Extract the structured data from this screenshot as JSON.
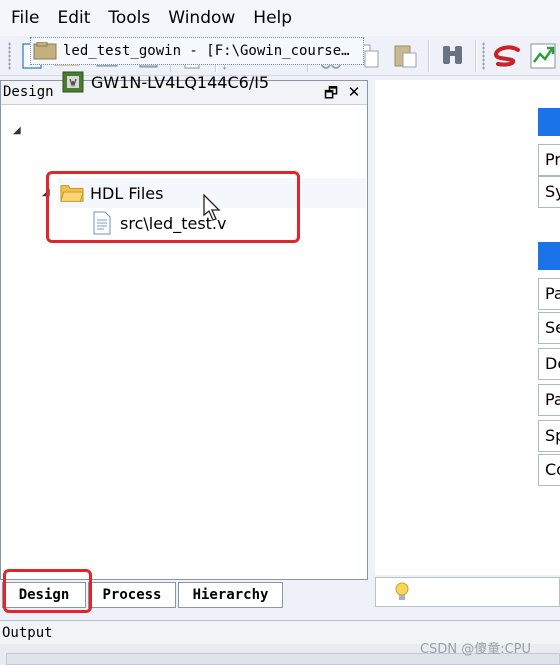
{
  "menu": [
    "File",
    "Edit",
    "Tools",
    "Window",
    "Help"
  ],
  "toolbar_icons": [
    "new-file-icon",
    "open-folder-icon",
    "save-icon",
    "save-all-icon",
    "print-icon",
    "undo-icon",
    "redo-icon",
    "cut-icon",
    "copy-icon",
    "paste-icon",
    "find-icon",
    "gowin-logo-icon",
    "run-icon"
  ],
  "design_panel": {
    "title": "Design",
    "restore_glyph": "🗗",
    "close_glyph": "✕",
    "project_label": "led_test_gowin - [F:\\Gowin_course…",
    "device_label": "GW1N-LV4LQ144C6/I5",
    "hdl_folder_label": "HDL Files",
    "file_label": "src\\led_test.v"
  },
  "bottom_tabs": [
    "Design",
    "Process",
    "Hierarchy"
  ],
  "right_panel": {
    "group1": [
      "Pr",
      "Sy"
    ],
    "group2": [
      "Pa",
      "Se",
      "De",
      "Pa",
      "Sp",
      "Co"
    ]
  },
  "output_title": "Output",
  "watermark": "CSDN @傻童:CPU",
  "colors": {
    "highlight_red": "#e0252b",
    "header_blue": "#1a73e8"
  }
}
